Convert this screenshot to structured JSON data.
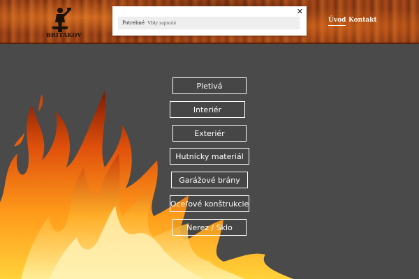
{
  "header": {
    "logo_text": "BRITAKOV",
    "nav": [
      {
        "label": "Úvod"
      },
      {
        "label": "Kontakt"
      }
    ]
  },
  "consent": {
    "category_label": "Potrebné",
    "category_status": "Vždy zapnuté",
    "close_icon": "close-icon"
  },
  "menu": [
    {
      "label": "Pletivá"
    },
    {
      "label": "Interiér"
    },
    {
      "label": "Exteriér"
    },
    {
      "label": "Hutnícky materiál"
    },
    {
      "label": "Garážové brány"
    },
    {
      "label": "Oceľové konštrukcie"
    },
    {
      "label": "Nerez / Sklo"
    }
  ],
  "colors": {
    "background": "#4a4a4a",
    "header_rust": "#8a3a12",
    "button_border": "#ffffff"
  }
}
